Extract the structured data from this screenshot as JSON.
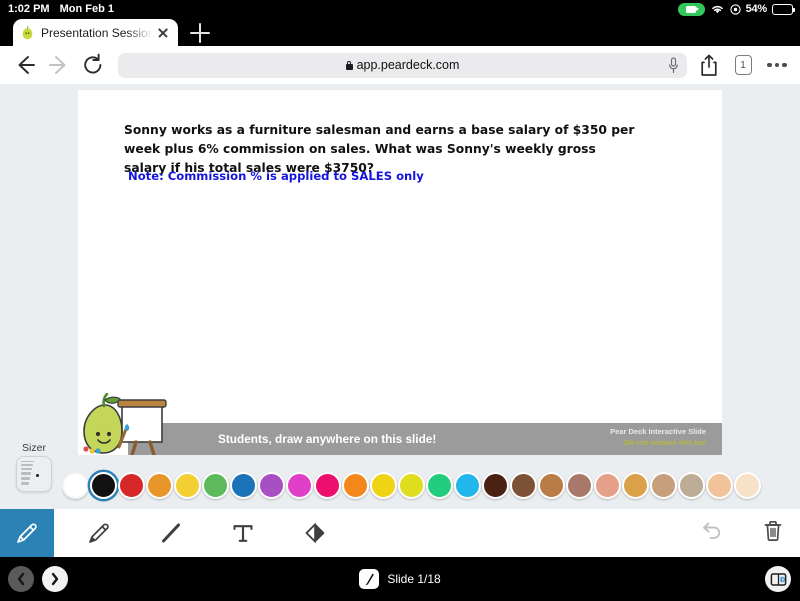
{
  "status_bar": {
    "time": "1:02 PM",
    "date": "Mon Feb 1",
    "battery_percent": "54%",
    "recording_icon": "screen-recording-badge",
    "wifi_icon": "wifi-icon",
    "location_icon": "location-icon"
  },
  "browser": {
    "tab": {
      "title": "Presentation Session Stu",
      "favicon": "pear-favicon",
      "close_icon": "close-icon"
    },
    "new_tab_icon": "plus-icon",
    "back_icon": "back-arrow-icon",
    "forward_icon": "forward-arrow-icon",
    "reload_icon": "reload-icon",
    "url": "app.peardeck.com",
    "lock_icon": "lock-icon",
    "mic_icon": "microphone-icon",
    "share_icon": "share-icon",
    "tab_count": "1",
    "more_icon": "more-options-icon"
  },
  "slide": {
    "question": "Sonny works as a furniture salesman and earns a base salary of $350 per week plus 6% commission on sales. What was Sonny's weekly gross salary if his total sales were $3750?",
    "note": "Note: Commission % is applied to SALES only",
    "peardeck_bar": {
      "prompt": "Students, draw anywhere on this slide!",
      "right_line1": "Pear Deck Interactive Slide",
      "right_line2": "Do not remove this bar",
      "mascot_icon": "pear-mascot-easel-icon"
    }
  },
  "sizer": {
    "label": "Sizer",
    "icon": "brush-size-picker"
  },
  "palette": {
    "selected_index": 1,
    "colors": [
      "#ffffff",
      "#111111",
      "#d62828",
      "#e8952a",
      "#f3cf33",
      "#5cb95c",
      "#1c74b8",
      "#a84fc4",
      "#e03fc7",
      "#ec0f6e",
      "#f4871c",
      "#efd416",
      "#dede1e",
      "#22cd7e",
      "#22b7ec",
      "#4a2213",
      "#7d5136",
      "#b97c47",
      "#a8796a",
      "#e5a08a",
      "#dba04a",
      "#c79f7c",
      "#bdad97",
      "#f0c39b",
      "#f7e2c8"
    ]
  },
  "toolbar": {
    "tools": [
      {
        "name": "pencil-tool",
        "icon": "pencil-icon",
        "active": true
      },
      {
        "name": "pen-tool",
        "icon": "pencil-outline-icon",
        "active": false
      },
      {
        "name": "line-tool",
        "icon": "line-icon",
        "active": false
      },
      {
        "name": "text-tool",
        "icon": "text-T-icon",
        "active": false
      },
      {
        "name": "eraser-tool",
        "icon": "eraser-icon",
        "active": false
      }
    ],
    "undo_icon": "undo-icon",
    "delete_icon": "trash-icon"
  },
  "bottom_nav": {
    "prev_icon": "chevron-left-icon",
    "next_icon": "chevron-right-icon",
    "slide_label": "Slide 1/18",
    "slide_icon": "brush-icon",
    "cast_icon": "projector-audio-icon"
  }
}
